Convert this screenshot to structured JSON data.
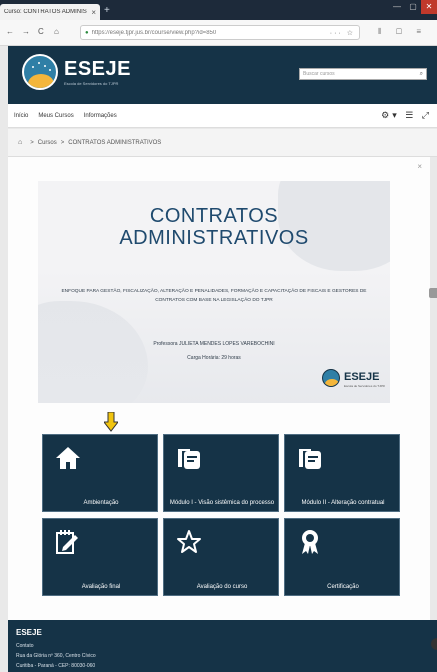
{
  "browser": {
    "tab_title": "Curso: CONTRATOS ADMINIS",
    "tab_close": "×",
    "new_tab": "+",
    "nav_back": "←",
    "nav_forward": "→",
    "nav_reload": "C",
    "nav_home": "⌂",
    "url": "https://eseje.tjpr.jus.br/course/view.php?id=850",
    "omni_actions": "··· ☆",
    "extensions": "⫴ ▢ ≡",
    "window_controls": [
      "—",
      "▢",
      "✕"
    ]
  },
  "header": {
    "logo_text": "ESEJE",
    "logo_sub": "Escola de Servidores do TJPR",
    "search_placeholder": "Buscar cursos",
    "search_icon": "⌕"
  },
  "menu": {
    "items": [
      "Início",
      "Meus Cursos",
      "Informações"
    ],
    "tools": "⚙▾ ☰ ⤢"
  },
  "breadcrumb": {
    "home_icon": "⌂",
    "separator": ">",
    "items": [
      "Cursos",
      "CONTRATOS ADMINISTRATIVOS"
    ]
  },
  "panel": {
    "close": "×"
  },
  "banner": {
    "title_line1": "CONTRATOS",
    "title_line2": "ADMINISTRATIVOS",
    "description": "Enfoque para gestão, fiscalização, alteração e penalidades, formação e capacitação de fiscais e gestores de contratos com base na legislação do TJPR",
    "professor": "Professora JULIETA MENDES LOPES VAREBOCHINI",
    "hours": "Carga Horária: 29 horas",
    "logo_text": "ESEJE",
    "logo_sub": "Escola de Servidores do TJPR"
  },
  "tiles": [
    {
      "label": "Ambientação",
      "icon": "home-icon"
    },
    {
      "label": "Módulo I - Visão sistêmica do processo",
      "icon": "document-icon"
    },
    {
      "label": "Módulo II - Alteração contratual",
      "icon": "document-icon"
    },
    {
      "label": "Avaliação final",
      "icon": "edit-icon"
    },
    {
      "label": "Avaliação do curso",
      "icon": "star-icon"
    },
    {
      "label": "Certificação",
      "icon": "award-icon"
    }
  ],
  "footer": {
    "title": "ESEJE",
    "contact_label": "Contato",
    "address": "Rua da Glória nº 360, Centro Cívico",
    "city": "Curitiba - Paraná - CEP: 80030-060"
  },
  "colors": {
    "brand_dark": "#153347",
    "accent_yellow": "#f4b63b",
    "title_blue": "#1f4a6e",
    "arrow_yellow": "#f1c40f"
  }
}
